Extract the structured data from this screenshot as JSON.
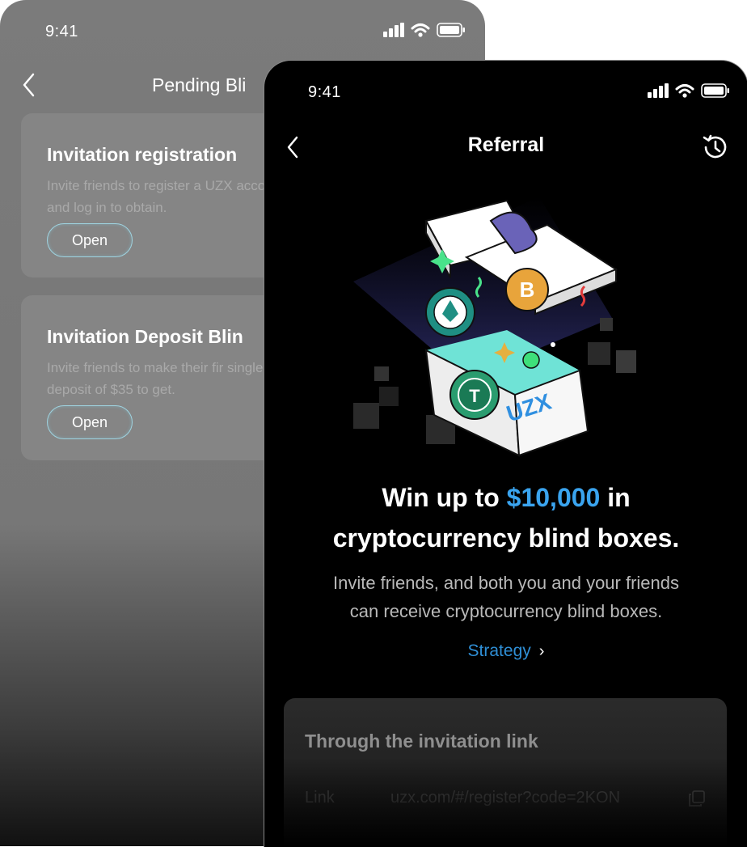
{
  "back_screen": {
    "status": {
      "time": "9:41"
    },
    "title": "Pending Bli",
    "cards": [
      {
        "title": "Invitation registration",
        "description": "Invite friends to register a UZX account, and log in to obtain.",
        "button": "Open"
      },
      {
        "title": "Invitation Deposit Blin",
        "description": "Invite friends to make their fir single deposit of $35 to get.",
        "button": "Open"
      }
    ]
  },
  "front_screen": {
    "status": {
      "time": "9:41"
    },
    "title": "Referral",
    "hero": {
      "brand": "UZX"
    },
    "headline": {
      "prefix": "Win up to ",
      "amount": "$10,000",
      "suffix": " in",
      "line2": "cryptocurrency blind boxes."
    },
    "subtitle": {
      "line1": "Invite friends, and both you and your friends",
      "line2": "can receive cryptocurrency blind boxes."
    },
    "strategy_link": "Strategy",
    "invite_card": {
      "title": "Through the invitation link",
      "link_label": "Link",
      "link_value": "uzx.com/#/register?code=2KON"
    }
  },
  "colors": {
    "accent": "#3aa4ef",
    "link": "#2f8fd6",
    "open_border": "#9fd3e0",
    "background_front": "#000000",
    "background_back": "#7b7b7b"
  },
  "icons": [
    "back-chevron-icon",
    "history-icon",
    "signal-icon",
    "wifi-icon",
    "battery-icon",
    "copy-icon",
    "chevron-right-icon"
  ]
}
